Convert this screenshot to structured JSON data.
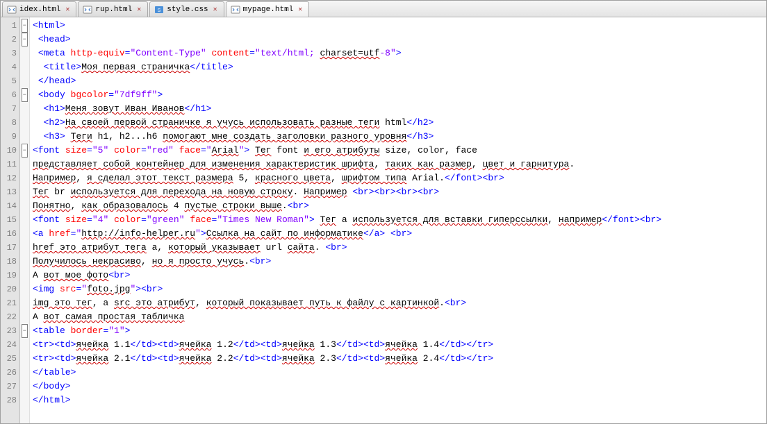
{
  "tabs": [
    {
      "label": "idex.html",
      "type": "html",
      "active": false
    },
    {
      "label": "rup.html",
      "type": "html",
      "active": false
    },
    {
      "label": "style.css",
      "type": "css",
      "active": false
    },
    {
      "label": "mypage.html",
      "type": "html",
      "active": true
    }
  ],
  "lines": {
    "first": 1,
    "count": 28
  },
  "fold": [
    "-",
    "-",
    "",
    "",
    "",
    "-",
    "",
    "",
    "",
    "-",
    "",
    "",
    "",
    "",
    "",
    "",
    "",
    "",
    "",
    "",
    "",
    "",
    "-",
    "",
    "",
    "",
    "",
    ""
  ],
  "code": [
    [
      [
        "t",
        "<html>"
      ]
    ],
    [
      [
        "tx",
        " "
      ],
      [
        "t",
        "<head>"
      ]
    ],
    [
      [
        "tx",
        " "
      ],
      [
        "t",
        "<meta"
      ],
      [
        "tx",
        " "
      ],
      [
        "a",
        "http-equiv"
      ],
      [
        "t",
        "="
      ],
      [
        "v",
        "\"Content-Type\""
      ],
      [
        "tx",
        " "
      ],
      [
        "a",
        "content"
      ],
      [
        "t",
        "="
      ],
      [
        "v",
        "\"text/html; "
      ],
      [
        "sp",
        "charset=utf"
      ],
      [
        "v",
        "-8\""
      ],
      [
        "t",
        ">"
      ]
    ],
    [
      [
        "tx",
        "  "
      ],
      [
        "t",
        "<title>"
      ],
      [
        "sp",
        "Моя первая страничка"
      ],
      [
        "t",
        "</title>"
      ]
    ],
    [
      [
        "tx",
        " "
      ],
      [
        "t",
        "</head>"
      ]
    ],
    [
      [
        "tx",
        " "
      ],
      [
        "t",
        "<body"
      ],
      [
        "tx",
        " "
      ],
      [
        "a",
        "bgcolor"
      ],
      [
        "t",
        "="
      ],
      [
        "v",
        "\"7df9ff\""
      ],
      [
        "t",
        ">"
      ]
    ],
    [
      [
        "tx",
        "  "
      ],
      [
        "t",
        "<h1>"
      ],
      [
        "sp",
        "Меня зовут Иван Иванов"
      ],
      [
        "t",
        "</h1>"
      ]
    ],
    [
      [
        "tx",
        "  "
      ],
      [
        "t",
        "<h2>"
      ],
      [
        "sp",
        "На своей первой страничке я учусь использовать разные теги"
      ],
      [
        "tx",
        " html"
      ],
      [
        "t",
        "</h2>"
      ]
    ],
    [
      [
        "tx",
        "  "
      ],
      [
        "t",
        "<h3>"
      ],
      [
        "tx",
        " "
      ],
      [
        "sp",
        "Теги"
      ],
      [
        "tx",
        " h1, h2...h6 "
      ],
      [
        "sp",
        "помогают мне создать заголовки разного уровня"
      ],
      [
        "t",
        "</h3>"
      ]
    ],
    [
      [
        "t",
        "<font"
      ],
      [
        "tx",
        " "
      ],
      [
        "a",
        "size"
      ],
      [
        "t",
        "="
      ],
      [
        "v",
        "\"5\""
      ],
      [
        "tx",
        " "
      ],
      [
        "a",
        "color"
      ],
      [
        "t",
        "="
      ],
      [
        "v",
        "\"red\""
      ],
      [
        "tx",
        " "
      ],
      [
        "a",
        "face"
      ],
      [
        "t",
        "="
      ],
      [
        "v",
        "\""
      ],
      [
        "sp",
        "Arial"
      ],
      [
        "v",
        "\""
      ],
      [
        "t",
        ">"
      ],
      [
        "tx",
        " "
      ],
      [
        "sp",
        "Тег"
      ],
      [
        "tx",
        " font "
      ],
      [
        "sp",
        "и его атрибуты"
      ],
      [
        "tx",
        " size, color, face"
      ]
    ],
    [
      [
        "sp",
        "представляет собой контейнер для изменения характеристик шрифта"
      ],
      [
        "tx",
        ", "
      ],
      [
        "sp",
        "таких как размер"
      ],
      [
        "tx",
        ", "
      ],
      [
        "sp",
        "цвет и гарнитура"
      ],
      [
        "tx",
        "."
      ]
    ],
    [
      [
        "sp",
        "Например"
      ],
      [
        "tx",
        ", "
      ],
      [
        "sp",
        "я сделал этот текст размера"
      ],
      [
        "tx",
        " 5, "
      ],
      [
        "sp",
        "красного цвета"
      ],
      [
        "tx",
        ", "
      ],
      [
        "sp",
        "шрифтом типа"
      ],
      [
        "tx",
        " Arial."
      ],
      [
        "t",
        "</font><br>"
      ]
    ],
    [
      [
        "sp",
        "Тег"
      ],
      [
        "tx",
        " br "
      ],
      [
        "sp",
        "используется для перехода на новую строку"
      ],
      [
        "tx",
        ". "
      ],
      [
        "sp",
        "Например"
      ],
      [
        "tx",
        " "
      ],
      [
        "t",
        "<br><br><br><br>"
      ]
    ],
    [
      [
        "sp",
        "Понятно"
      ],
      [
        "tx",
        ", "
      ],
      [
        "sp",
        "как образовалось"
      ],
      [
        "tx",
        " 4 "
      ],
      [
        "sp",
        "пустые строки выше"
      ],
      [
        "tx",
        "."
      ],
      [
        "t",
        "<br>"
      ]
    ],
    [
      [
        "t",
        "<font"
      ],
      [
        "tx",
        " "
      ],
      [
        "a",
        "size"
      ],
      [
        "t",
        "="
      ],
      [
        "v",
        "\"4\""
      ],
      [
        "tx",
        " "
      ],
      [
        "a",
        "color"
      ],
      [
        "t",
        "="
      ],
      [
        "v",
        "\"green\""
      ],
      [
        "tx",
        " "
      ],
      [
        "a",
        "face"
      ],
      [
        "t",
        "="
      ],
      [
        "v",
        "\"Times New Roman\""
      ],
      [
        "t",
        ">"
      ],
      [
        "tx",
        " "
      ],
      [
        "sp",
        "Тег"
      ],
      [
        "tx",
        " a "
      ],
      [
        "sp",
        "используется для вставки гиперссылки"
      ],
      [
        "tx",
        ", "
      ],
      [
        "sp",
        "например"
      ],
      [
        "t",
        "</font><br>"
      ]
    ],
    [
      [
        "t",
        "<a"
      ],
      [
        "tx",
        " "
      ],
      [
        "a",
        "href"
      ],
      [
        "t",
        "="
      ],
      [
        "v",
        "\""
      ],
      [
        "sp",
        "http://info-helper.ru"
      ],
      [
        "v",
        "\""
      ],
      [
        "t",
        ">"
      ],
      [
        "sp",
        "Ссылка на сайт по информатике"
      ],
      [
        "t",
        "</a>"
      ],
      [
        "tx",
        " "
      ],
      [
        "t",
        "<br>"
      ]
    ],
    [
      [
        "sp",
        "href это атрибут тега"
      ],
      [
        "tx",
        " a, "
      ],
      [
        "sp",
        "который указывает"
      ],
      [
        "tx",
        " url "
      ],
      [
        "sp",
        "сайта"
      ],
      [
        "tx",
        ". "
      ],
      [
        "t",
        "<br>"
      ]
    ],
    [
      [
        "sp",
        "Получилось некрасиво"
      ],
      [
        "tx",
        ", "
      ],
      [
        "sp",
        "но я просто учусь"
      ],
      [
        "tx",
        "."
      ],
      [
        "t",
        "<br>"
      ]
    ],
    [
      [
        "tx",
        "А "
      ],
      [
        "sp",
        "вот мое фото"
      ],
      [
        "t",
        "<br>"
      ]
    ],
    [
      [
        "t",
        "<img"
      ],
      [
        "tx",
        " "
      ],
      [
        "a",
        "src"
      ],
      [
        "t",
        "="
      ],
      [
        "v",
        "\""
      ],
      [
        "sp",
        "foto.jpg"
      ],
      [
        "v",
        "\""
      ],
      [
        "t",
        "><br>"
      ]
    ],
    [
      [
        "sp",
        "img это тег"
      ],
      [
        "tx",
        ", а "
      ],
      [
        "sp",
        "src это атрибут"
      ],
      [
        "tx",
        ", "
      ],
      [
        "sp",
        "который показывает путь к файлу с картинкой"
      ],
      [
        "tx",
        "."
      ],
      [
        "t",
        "<br>"
      ]
    ],
    [
      [
        "tx",
        "А "
      ],
      [
        "sp",
        "вот самая простая табличка"
      ]
    ],
    [
      [
        "t",
        "<table"
      ],
      [
        "tx",
        " "
      ],
      [
        "a",
        "border"
      ],
      [
        "t",
        "="
      ],
      [
        "v",
        "\"1\""
      ],
      [
        "t",
        ">"
      ]
    ],
    [
      [
        "t",
        "<tr><td>"
      ],
      [
        "sp",
        "ячейка"
      ],
      [
        "tx",
        " 1.1"
      ],
      [
        "t",
        "</td><td>"
      ],
      [
        "sp",
        "ячейка"
      ],
      [
        "tx",
        " 1.2"
      ],
      [
        "t",
        "</td><td>"
      ],
      [
        "sp",
        "ячейка"
      ],
      [
        "tx",
        " 1.3"
      ],
      [
        "t",
        "</td><td>"
      ],
      [
        "sp",
        "ячейка"
      ],
      [
        "tx",
        " 1.4"
      ],
      [
        "t",
        "</td></tr>"
      ]
    ],
    [
      [
        "t",
        "<tr><td>"
      ],
      [
        "sp",
        "ячейка"
      ],
      [
        "tx",
        " 2.1"
      ],
      [
        "t",
        "</td><td>"
      ],
      [
        "sp",
        "ячейка"
      ],
      [
        "tx",
        " 2.2"
      ],
      [
        "t",
        "</td><td>"
      ],
      [
        "sp",
        "ячейка"
      ],
      [
        "tx",
        " 2.3"
      ],
      [
        "t",
        "</td><td>"
      ],
      [
        "sp",
        "ячейка"
      ],
      [
        "tx",
        " 2.4"
      ],
      [
        "t",
        "</td></tr>"
      ]
    ],
    [
      [
        "t",
        "</table>"
      ]
    ],
    [
      [
        "t",
        "</body>"
      ]
    ],
    [
      [
        "t",
        "</html>"
      ]
    ]
  ]
}
